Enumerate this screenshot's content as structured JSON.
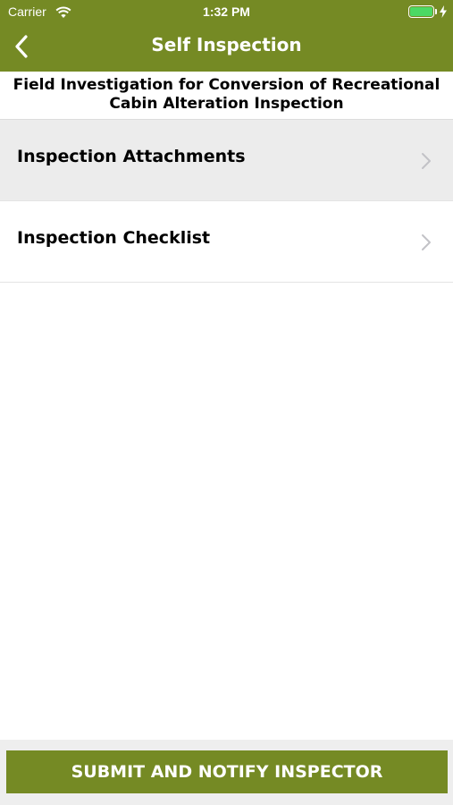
{
  "status_bar": {
    "carrier": "Carrier",
    "time": "1:32 PM",
    "wifi_icon": "wifi-icon",
    "battery_icon": "battery-icon",
    "battery_level": 1.0,
    "charging_icon": "bolt-icon"
  },
  "nav": {
    "title": "Self Inspection",
    "back_icon": "chevron-left-icon"
  },
  "inspection": {
    "title": "Field Investigation for Conversion of Recreational Cabin Alteration Inspection"
  },
  "menu": {
    "items": [
      {
        "label": "Inspection Attachments",
        "icon": "chevron-right-icon",
        "selected": true
      },
      {
        "label": "Inspection Checklist",
        "icon": "chevron-right-icon",
        "selected": false
      }
    ]
  },
  "footer": {
    "submit_label": "SUBMIT AND NOTIFY INSPECTOR"
  },
  "colors": {
    "brand": "#758a24",
    "selected_row": "#ececec",
    "battery": "#4cd964"
  }
}
